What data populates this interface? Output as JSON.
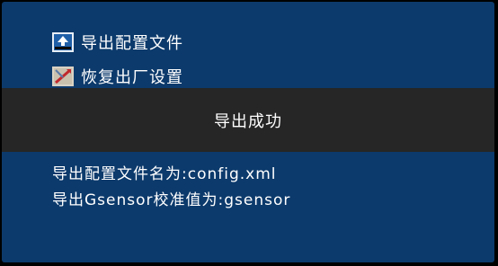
{
  "menu": {
    "items": [
      {
        "label": "导出配置文件",
        "icon": "export-icon"
      },
      {
        "label": "恢复出厂设置",
        "icon": "factory-reset-icon"
      }
    ]
  },
  "dialog": {
    "message": "导出成功"
  },
  "info": {
    "filename_line": "导出配置文件名为:config.xml",
    "gsensor_line": "导出Gsensor校准值为:gsensor"
  },
  "colors": {
    "background": "#0c3a6c",
    "overlay": "#262626",
    "text": "#ffffff"
  }
}
